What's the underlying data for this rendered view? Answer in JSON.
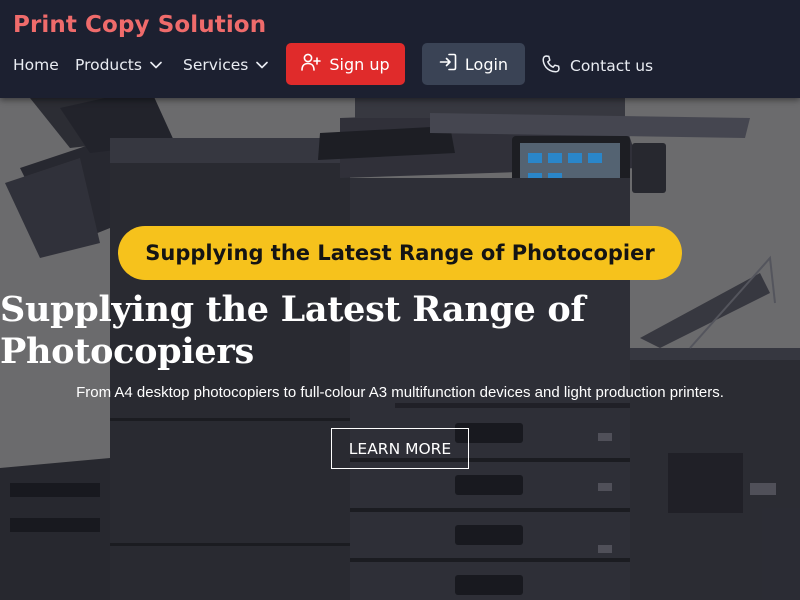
{
  "nav": {
    "brand": "Print Copy Solution",
    "links": [
      {
        "label": "Home"
      },
      {
        "label": "Products"
      },
      {
        "label": "Services"
      }
    ],
    "signup_label": "Sign up",
    "login_label": "Login",
    "contact_label": "Contact us"
  },
  "hero": {
    "badge": "Supplying the Latest Range of Photocopier",
    "title_line1": "Supplying the Latest Range of",
    "title_line2": "Photocopiers",
    "subtitle": "From A4 desktop photocopiers to full-colour A3 multifunction devices and light production printers.",
    "cta_label": "LEARN MORE"
  },
  "colors": {
    "nav_bg": "#1c2030",
    "brand": "#ef6b6b",
    "signup_bg": "#e02b2b",
    "login_bg": "#3a4355",
    "badge_bg": "#f6c21c"
  },
  "icons": {
    "products_chevron": "chevron-down-icon",
    "services_chevron": "chevron-down-icon",
    "signup": "user-plus-icon",
    "login": "login-icon",
    "contact": "phone-icon"
  }
}
